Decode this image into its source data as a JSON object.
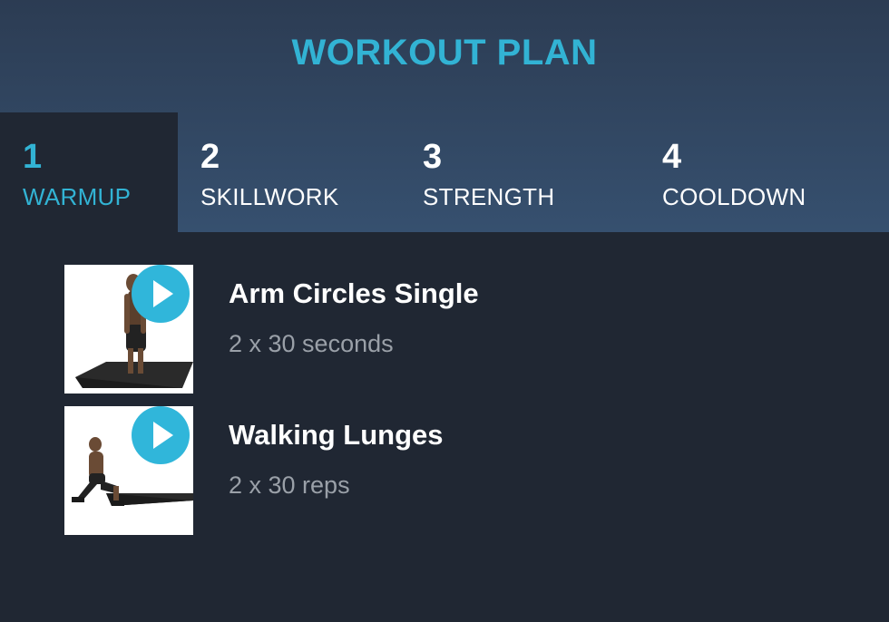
{
  "header": {
    "title": "WORKOUT PLAN"
  },
  "tabs": [
    {
      "number": "1",
      "label": "WARMUP",
      "active": true
    },
    {
      "number": "2",
      "label": "SKILLWORK",
      "active": false
    },
    {
      "number": "3",
      "label": "STRENGTH",
      "active": false
    },
    {
      "number": "4",
      "label": "COOLDOWN",
      "active": false
    }
  ],
  "exercises": [
    {
      "name": "Arm Circles Single",
      "detail": "2 x 30 seconds",
      "icon": "play-icon"
    },
    {
      "name": "Walking Lunges",
      "detail": "2 x 30 reps",
      "icon": "play-icon"
    }
  ],
  "colors": {
    "accent": "#32b3d4",
    "background": "#202733",
    "header_top": "#2c3c53",
    "header_bottom": "#36506f",
    "secondary_text": "#9aa0a8"
  }
}
